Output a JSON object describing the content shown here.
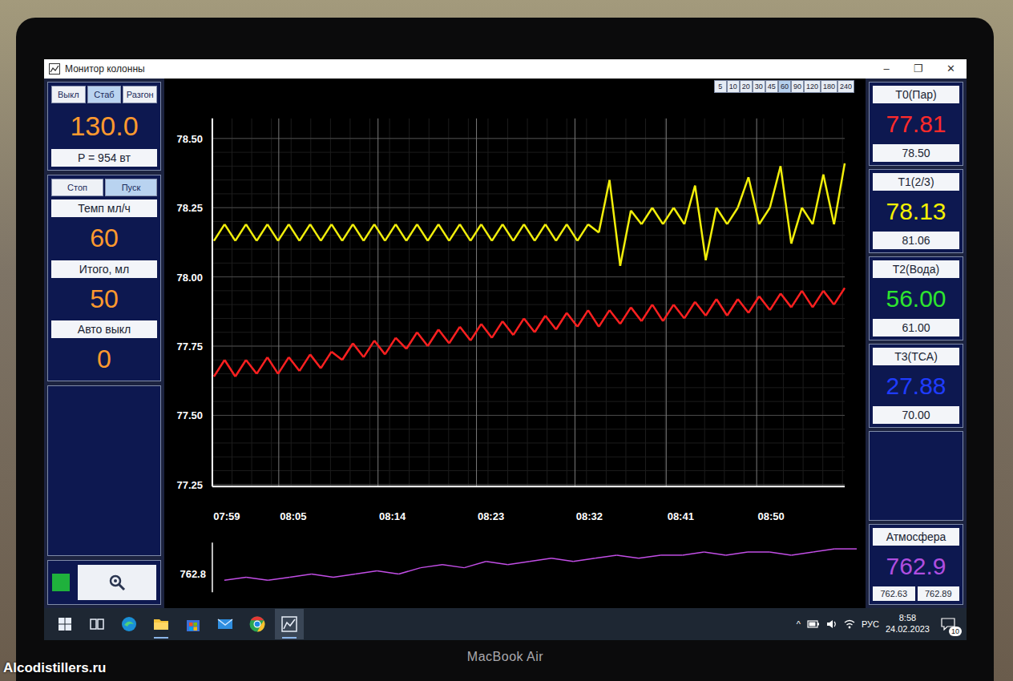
{
  "window": {
    "title": "Монитор колонны",
    "controls": [
      "–",
      "❐",
      "✕"
    ]
  },
  "modes": [
    {
      "label": "Выкл",
      "selected": false
    },
    {
      "label": "Стаб",
      "selected": true
    },
    {
      "label": "Разгон",
      "selected": false
    }
  ],
  "power": {
    "setpoint": "130.0",
    "reading": "P = 954 вт"
  },
  "pump": {
    "buttons": [
      {
        "label": "Стоп",
        "selected": false
      },
      {
        "label": "Пуск",
        "selected": true
      }
    ],
    "fields": [
      {
        "label": "Темп мл/ч",
        "value": "60"
      },
      {
        "label": "Итого, мл",
        "value": "50"
      },
      {
        "label": "Авто выкл",
        "value": "0"
      }
    ]
  },
  "indicator": {
    "on": true
  },
  "time_ranges": [
    {
      "label": "5",
      "selected": false
    },
    {
      "label": "10",
      "selected": false
    },
    {
      "label": "20",
      "selected": false
    },
    {
      "label": "30",
      "selected": false
    },
    {
      "label": "45",
      "selected": false
    },
    {
      "label": "60",
      "selected": true
    },
    {
      "label": "90",
      "selected": false
    },
    {
      "label": "120",
      "selected": false
    },
    {
      "label": "180",
      "selected": false
    },
    {
      "label": "240",
      "selected": false
    }
  ],
  "chart": {
    "y_ticks": [
      "78.50",
      "78.25",
      "78.00",
      "77.75",
      "77.50",
      "77.25"
    ],
    "x_ticks": [
      "07:59",
      "08:05",
      "08:14",
      "08:23",
      "08:32",
      "08:41",
      "08:50"
    ],
    "series": [
      {
        "color": "#ff2020",
        "values": [
          77.64,
          77.7,
          77.64,
          77.7,
          77.65,
          77.71,
          77.65,
          77.71,
          77.66,
          77.72,
          77.67,
          77.73,
          77.7,
          77.76,
          77.71,
          77.77,
          77.72,
          77.78,
          77.74,
          77.8,
          77.75,
          77.81,
          77.76,
          77.82,
          77.77,
          77.83,
          77.78,
          77.84,
          77.79,
          77.85,
          77.8,
          77.86,
          77.81,
          77.87,
          77.82,
          77.88,
          77.82,
          77.88,
          77.83,
          77.89,
          77.84,
          77.9,
          77.84,
          77.9,
          77.85,
          77.91,
          77.86,
          77.92,
          77.86,
          77.92,
          77.87,
          77.93,
          77.88,
          77.94,
          77.89,
          77.95,
          77.89,
          77.95,
          77.9,
          77.96
        ]
      },
      {
        "color": "#f2ef0a",
        "values": [
          78.13,
          78.19,
          78.13,
          78.19,
          78.13,
          78.19,
          78.13,
          78.19,
          78.13,
          78.19,
          78.13,
          78.19,
          78.13,
          78.19,
          78.13,
          78.19,
          78.13,
          78.19,
          78.13,
          78.19,
          78.13,
          78.19,
          78.13,
          78.19,
          78.13,
          78.19,
          78.13,
          78.19,
          78.13,
          78.19,
          78.13,
          78.19,
          78.13,
          78.19,
          78.13,
          78.19,
          78.16,
          78.35,
          78.04,
          78.24,
          78.19,
          78.25,
          78.19,
          78.25,
          78.19,
          78.33,
          78.06,
          78.25,
          78.19,
          78.25,
          78.36,
          78.19,
          78.25,
          78.4,
          78.12,
          78.25,
          78.19,
          78.37,
          78.19,
          78.41
        ]
      }
    ],
    "pressure": {
      "tick": "762.8",
      "color": "#c24ee6",
      "values": [
        762.8,
        762.81,
        762.8,
        762.81,
        762.82,
        762.81,
        762.82,
        762.83,
        762.82,
        762.84,
        762.85,
        762.84,
        762.86,
        762.85,
        762.86,
        762.87,
        762.86,
        762.87,
        762.88,
        762.87,
        762.88,
        762.88,
        762.89,
        762.88,
        762.89,
        762.89,
        762.88,
        762.89,
        762.9,
        762.9
      ]
    }
  },
  "sensors": [
    {
      "label": "T0(Пар)",
      "value": "77.81",
      "setpoint": "78.50",
      "color": "#ff2a2a"
    },
    {
      "label": "T1(2/3)",
      "value": "78.13",
      "setpoint": "81.06",
      "color": "#f5f000"
    },
    {
      "label": "T2(Вода)",
      "value": "56.00",
      "setpoint": "61.00",
      "color": "#2ee62e"
    },
    {
      "label": "T3(TCA)",
      "value": "27.88",
      "setpoint": "70.00",
      "color": "#1f3cff"
    }
  ],
  "atmosphere": {
    "label": "Атмосфера",
    "value": "762.9",
    "min": "762.63",
    "max": "762.89",
    "color": "#b04ee0"
  },
  "taskbar": {
    "apps": [
      {
        "kind": "start",
        "open": false,
        "active": false
      },
      {
        "kind": "taskview",
        "open": false,
        "active": false
      },
      {
        "kind": "edge",
        "open": false,
        "active": false
      },
      {
        "kind": "explorer",
        "open": true,
        "active": false
      },
      {
        "kind": "store",
        "open": false,
        "active": false
      },
      {
        "kind": "mail",
        "open": false,
        "active": false
      },
      {
        "kind": "chrome",
        "open": false,
        "active": false
      },
      {
        "kind": "monitor",
        "open": true,
        "active": true
      }
    ]
  },
  "tray": {
    "chevron": "^",
    "language": "РУС",
    "time": "8:58",
    "date": "24.02.2023",
    "notifications": "10"
  },
  "device": {
    "label": "MacBook Air"
  },
  "watermark": "Alcodistillers.ru"
}
